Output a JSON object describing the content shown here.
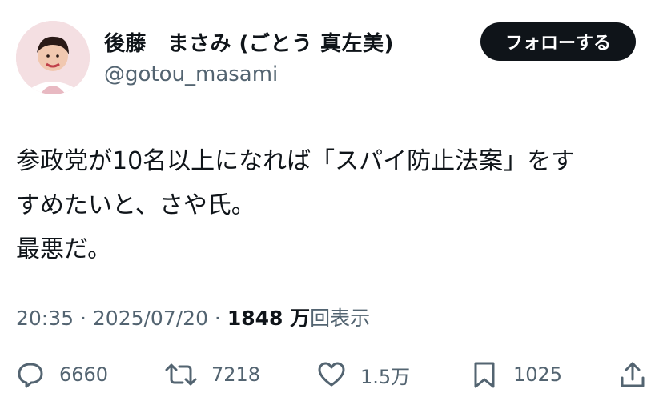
{
  "author": {
    "display_name": "後藤　まさみ (ごとう 真左美)",
    "handle": "@gotou_masami",
    "avatar_icon": "avatar-photo"
  },
  "follow_button": {
    "label": "フォローする"
  },
  "tweet": {
    "lines": [
      "参政党が10名以上になれば「スパイ防止法案」をす",
      "すめたいと、さや氏。",
      "最悪だ。"
    ]
  },
  "meta": {
    "time": "20:35",
    "separator1": " · ",
    "date": "2025/07/20",
    "separator2": " · ",
    "views_count": "1848 万",
    "views_label": "回表示"
  },
  "actions": {
    "replies": {
      "icon": "reply-icon",
      "count": "6660"
    },
    "retweets": {
      "icon": "retweet-icon",
      "count": "7218"
    },
    "likes": {
      "icon": "heart-icon",
      "count": "1.5万"
    },
    "bookmarks": {
      "icon": "bookmark-icon",
      "count": "1025"
    },
    "share": {
      "icon": "share-icon"
    }
  },
  "colors": {
    "text_primary": "#0f1419",
    "text_secondary": "#536471",
    "button_bg": "#0f1419",
    "button_text": "#ffffff"
  }
}
